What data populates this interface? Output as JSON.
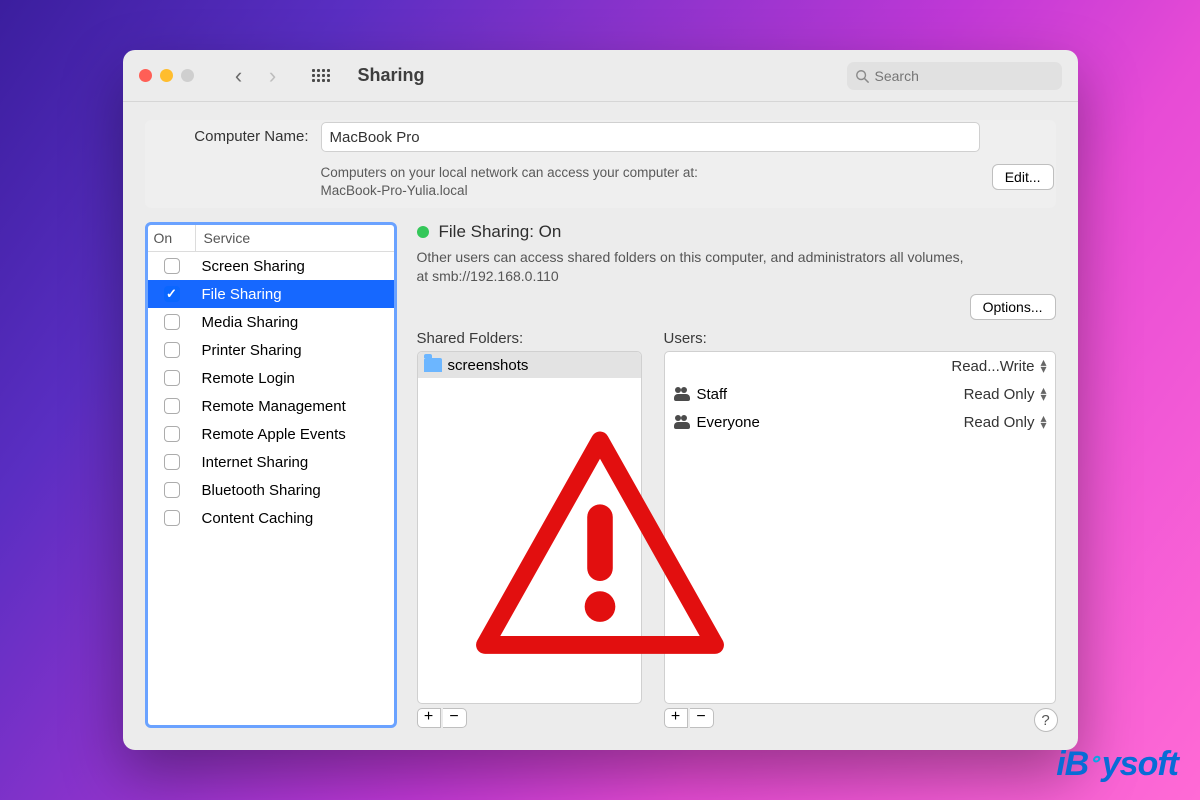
{
  "window": {
    "title": "Sharing"
  },
  "search": {
    "placeholder": "Search",
    "value": ""
  },
  "computer_name": {
    "label": "Computer Name:",
    "value": "MacBook Pro",
    "hint": "Computers on your local network can access your computer at:\nMacBook-Pro-Yulia.local",
    "edit_label": "Edit..."
  },
  "services": {
    "header_on": "On",
    "header_service": "Service",
    "items": [
      {
        "label": "Screen Sharing",
        "checked": false
      },
      {
        "label": "File Sharing",
        "checked": true
      },
      {
        "label": "Media Sharing",
        "checked": false
      },
      {
        "label": "Printer Sharing",
        "checked": false
      },
      {
        "label": "Remote Login",
        "checked": false
      },
      {
        "label": "Remote Management",
        "checked": false
      },
      {
        "label": "Remote Apple Events",
        "checked": false
      },
      {
        "label": "Internet Sharing",
        "checked": false
      },
      {
        "label": "Bluetooth Sharing",
        "checked": false
      },
      {
        "label": "Content Caching",
        "checked": false
      }
    ],
    "selected_index": 1
  },
  "status": {
    "title": "File Sharing: On",
    "desc": "Other users can access shared folders on this computer, and administrators all volumes, at smb://192.168.0.110",
    "options_label": "Options..."
  },
  "shared_folders": {
    "title": "Shared Folders:",
    "items": [
      {
        "label": "screenshots",
        "selected": true
      }
    ]
  },
  "users": {
    "title": "Users:",
    "items": [
      {
        "name": "",
        "permission": "Read...Write",
        "hidden_name": true
      },
      {
        "name": "Staff",
        "permission": "Read Only"
      },
      {
        "name": "Everyone",
        "permission": "Read Only"
      }
    ]
  },
  "buttons": {
    "plus": "+",
    "minus": "−",
    "help": "?"
  },
  "watermark": "iBoysoft"
}
